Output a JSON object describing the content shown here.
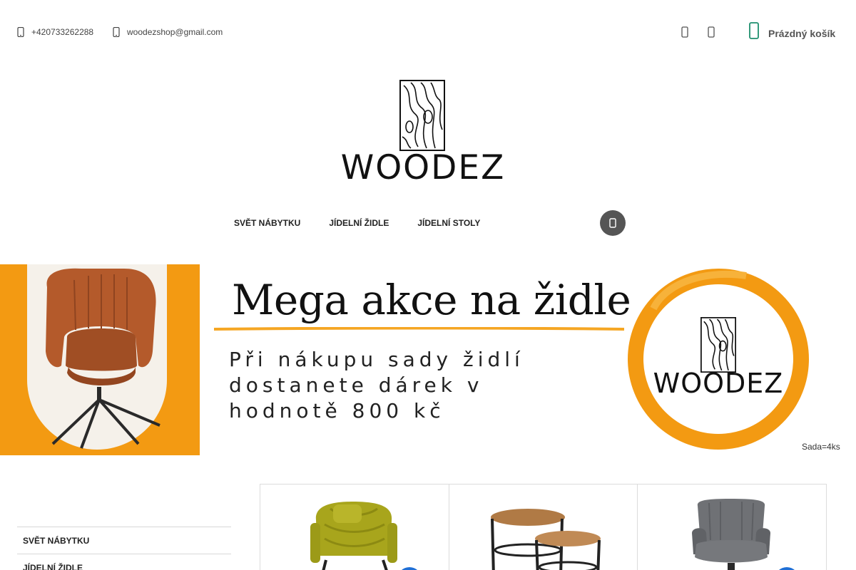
{
  "header": {
    "phone": "+420733262288",
    "email": "woodezshop@gmail.com",
    "icons": [
      "phone-icon",
      "mail-icon",
      "user-icon",
      "heart-icon",
      "cart-icon"
    ],
    "cart_label": "Prázdný košík"
  },
  "logo": {
    "text": "WOODEZ"
  },
  "nav": {
    "items": [
      "SVĚT NÁBYTKU",
      "JÍDELNÍ ŽIDLE",
      "JÍDELNÍ STOLY"
    ],
    "search_icon": "search-icon"
  },
  "banner": {
    "title": "Mega akce na židle",
    "subtitle": "Při nákupu sady židlí\ndostanete dárek v\nhodnotě 800 kč",
    "logo_text": "WOODEZ",
    "note": "Sada=4ks",
    "colors": {
      "orange": "#f39a12",
      "accent": "#f5a623"
    }
  },
  "sidebar": {
    "items": [
      "SVĚT NÁBYTKU",
      "JÍDELNÍ ŽIDLE"
    ]
  },
  "products": {
    "images": [
      "green-armchair-image",
      "nesting-tables-image",
      "grey-chair-image"
    ]
  }
}
